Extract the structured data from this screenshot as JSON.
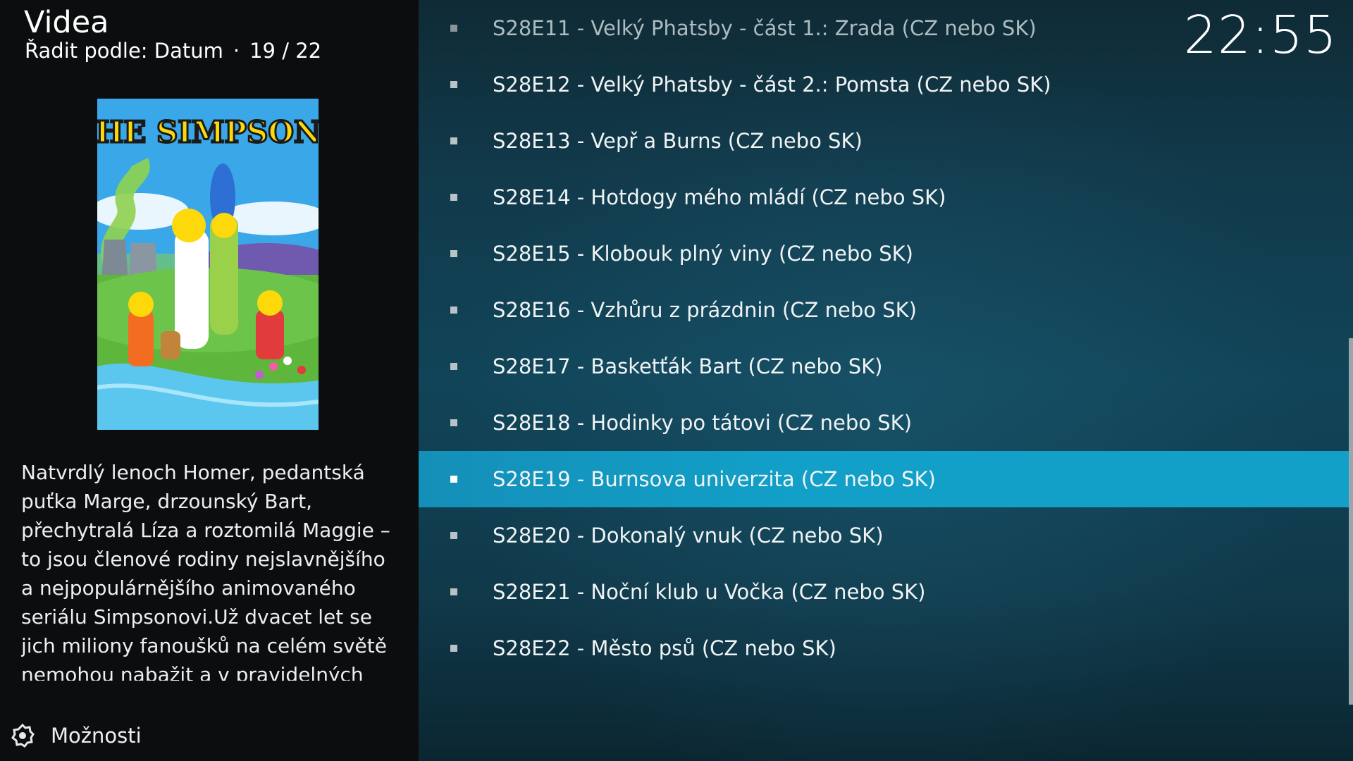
{
  "header": {
    "title": "Videa",
    "sort_label": "Řadit podle: Datum",
    "separator": "·",
    "position": "19 / 22"
  },
  "clock": "22:55",
  "poster": {
    "title_text": "THE SIMPSONS"
  },
  "plot": "Natvrdlý lenoch Homer, pedantská puťka Marge, drzounský Bart, přechytralá Líza a roztomilá Maggie – to jsou členové rodiny nejslavnějšího a nejpopulárnějšího animovaného seriálu Simpsonovi.Už dvacet let se jich miliony fanoušků na celém světě nemohou nabažit a v pravidelných",
  "options": {
    "label": "Možnosti",
    "icon": "options-gear-icon"
  },
  "episodes": [
    {
      "label": "S28E11 - Velký Phatsby - část 1.: Zrada  (CZ nebo SK)",
      "selected": false,
      "faded": true
    },
    {
      "label": "S28E12 - Velký Phatsby - část 2.: Pomsta  (CZ nebo SK)",
      "selected": false,
      "faded": false
    },
    {
      "label": "S28E13 - Vepř a Burns (CZ nebo SK)",
      "selected": false,
      "faded": false
    },
    {
      "label": "S28E14 - Hotdogy mého mládí (CZ nebo SK)",
      "selected": false,
      "faded": false
    },
    {
      "label": "S28E15 - Klobouk plný viny (CZ nebo SK)",
      "selected": false,
      "faded": false
    },
    {
      "label": "S28E16 - Vzhůru z prázdnin (CZ nebo SK)",
      "selected": false,
      "faded": false
    },
    {
      "label": "S28E17 - Basketťák Bart (CZ nebo SK)",
      "selected": false,
      "faded": false
    },
    {
      "label": "S28E18 - Hodinky po tátovi (CZ nebo SK)",
      "selected": false,
      "faded": false
    },
    {
      "label": "S28E19 - Burnsova univerzita (CZ nebo SK)",
      "selected": true,
      "faded": false
    },
    {
      "label": "S28E20 - Dokonalý vnuk (CZ nebo SK)",
      "selected": false,
      "faded": false
    },
    {
      "label": "S28E21 - Noční klub u Vočka (CZ nebo SK)",
      "selected": false,
      "faded": false
    },
    {
      "label": "S28E22 - Město psů (CZ nebo SK)",
      "selected": false,
      "faded": false
    }
  ],
  "colors": {
    "selected_row": "#12a0c8",
    "list_background": "#114458",
    "side_panel": "#0c0d0e"
  }
}
